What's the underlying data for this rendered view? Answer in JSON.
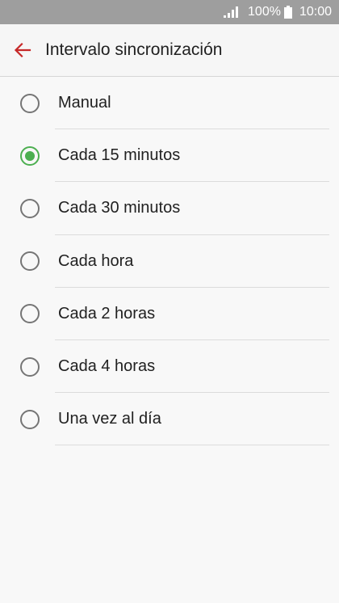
{
  "status_bar": {
    "battery": "100%",
    "time": "10:00",
    "icons": [
      "signal-icon",
      "battery-icon"
    ]
  },
  "app_bar": {
    "back_icon": "arrow-left-icon",
    "title": "Intervalo sincronización",
    "accent": "#c62828"
  },
  "options": {
    "selected_index": 1,
    "selected_color": "#4caf50",
    "items": [
      {
        "label": "Manual"
      },
      {
        "label": "Cada 15 minutos"
      },
      {
        "label": "Cada 30 minutos"
      },
      {
        "label": "Cada hora"
      },
      {
        "label": "Cada 2 horas"
      },
      {
        "label": "Cada 4 horas"
      },
      {
        "label": "Una vez al día"
      }
    ]
  }
}
